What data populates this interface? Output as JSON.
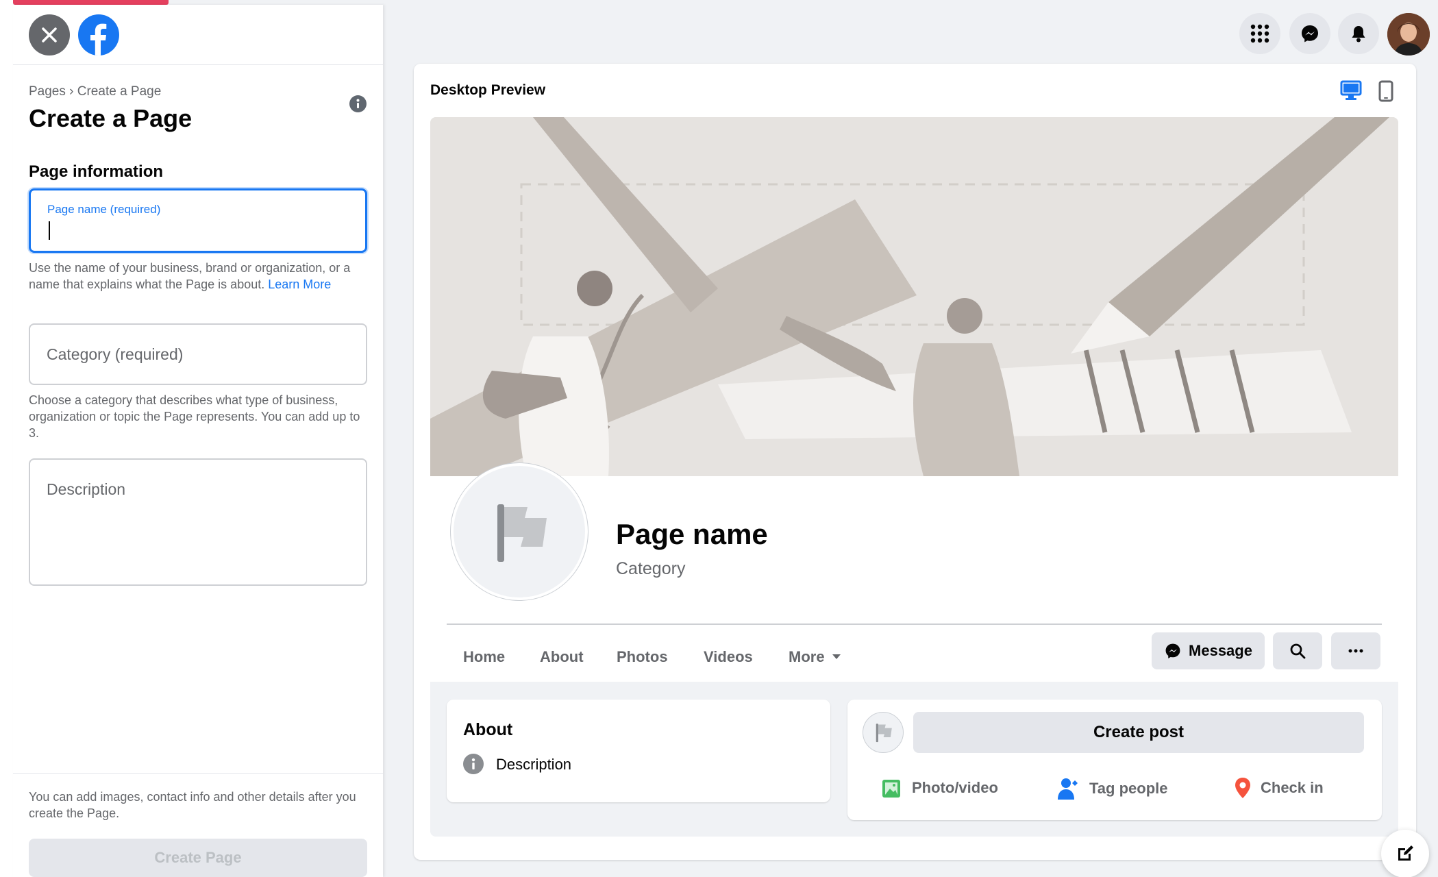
{
  "header": {
    "breadcrumb": "Pages › Create a Page",
    "title": "Create a Page"
  },
  "form": {
    "section_title": "Page information",
    "page_name": {
      "label": "Page name (required)",
      "value": ""
    },
    "page_name_help": "Use the name of your business, brand or organization, or a name that explains what the Page is about.",
    "learn_more": "Learn More",
    "category_placeholder": "Category (required)",
    "category_help": "Choose a category that describes what type of business, organization or topic the Page represents. You can add up to 3.",
    "description_placeholder": "Description",
    "footer_note": "You can add images, contact info and other details after you create the Page.",
    "create_button": "Create Page"
  },
  "preview": {
    "title": "Desktop Preview",
    "page_name": "Page name",
    "category": "Category",
    "tabs": [
      "Home",
      "About",
      "Photos",
      "Videos",
      "More"
    ],
    "message_button": "Message",
    "about_title": "About",
    "about_description": "Description",
    "create_post": "Create post",
    "post_actions": [
      "Photo/video",
      "Tag people",
      "Check in"
    ]
  },
  "colors": {
    "brand": "#1877f2",
    "accent_line": "#e4405f"
  },
  "icons": [
    "close-icon",
    "facebook-logo",
    "info-icon",
    "menu-grid-icon",
    "messenger-icon",
    "bell-icon",
    "desktop-icon",
    "mobile-icon",
    "flag-icon",
    "messenger-icon",
    "search-icon",
    "more-icon",
    "photo-icon",
    "tag-people-icon",
    "location-pin-icon",
    "compose-icon"
  ]
}
